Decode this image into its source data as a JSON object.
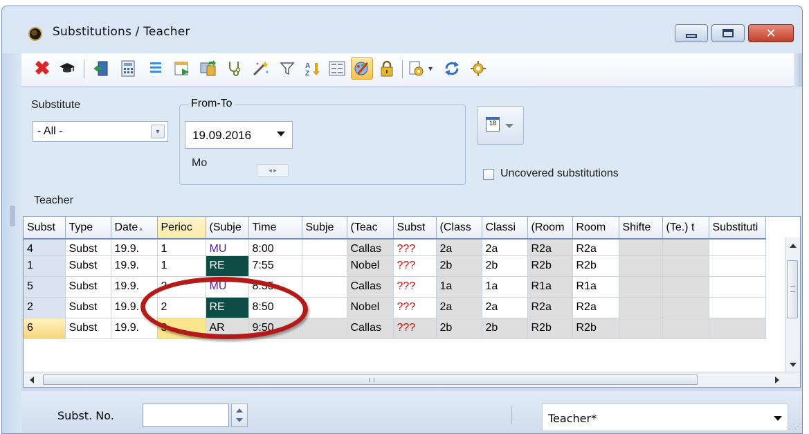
{
  "window": {
    "title": "Substitutions / Teacher"
  },
  "toolbar": {
    "icons": [
      "delete-icon",
      "teacher-cap-icon",
      "exit-icon",
      "calculator-icon",
      "list-icon",
      "timetable-icon",
      "move-icon",
      "stethoscope-icon",
      "magic-wand-icon",
      "filter-icon",
      "sort-icon",
      "grid-icon",
      "edit-colors-icon",
      "lock-icon",
      "print-icon",
      "refresh-icon",
      "settings-icon"
    ],
    "active_icon": "edit-colors-icon",
    "dropdown_glyph": "▾"
  },
  "filters": {
    "substitute_label": "Substitute",
    "substitute_value": "- All -",
    "from_to_label": "From-To",
    "date_value": "19.09.2016",
    "weekday": "Mo",
    "spin_glyphs": "◂ ▸",
    "uncovered_label": "Uncovered substitutions",
    "uncovered_checked": false,
    "teacher_label": "Teacher"
  },
  "grid": {
    "columns": [
      "Subst",
      "Type",
      "Date",
      "Perioc",
      "(Subje",
      "Time",
      "Subje",
      "(Teac",
      "Subst",
      "(Class",
      "Classi",
      "(Room",
      "Room",
      "Shifte",
      "(Te.) t",
      "Substituti"
    ],
    "sort_indicator": "▲",
    "rows": [
      {
        "subst": "4",
        "type": "Subst",
        "date": "19.9.",
        "period": "1",
        "subject_old": "MU",
        "time": "8:00",
        "subject": "",
        "teacher_old": "Callas",
        "teacher": "???",
        "class_old": "2a",
        "class": "2a",
        "room_old": "R2a",
        "room": "R2a"
      },
      {
        "subst": "1",
        "type": "Subst",
        "date": "19.9.",
        "period": "1",
        "subject_old": "RE",
        "time": "7:55",
        "subject": "",
        "teacher_old": "Nobel",
        "teacher": "???",
        "class_old": "2b",
        "class": "2b",
        "room_old": "R2b",
        "room": "R2b"
      },
      {
        "subst": "5",
        "type": "Subst",
        "date": "19.9.",
        "period": "2",
        "subject_old": "MU",
        "time": "8:55",
        "subject": "",
        "teacher_old": "Callas",
        "teacher": "???",
        "class_old": "1a",
        "class": "1a",
        "room_old": "R1a",
        "room": "R1a"
      },
      {
        "subst": "2",
        "type": "Subst",
        "date": "19.9.",
        "period": "2",
        "subject_old": "RE",
        "time": "8:50",
        "subject": "",
        "teacher_old": "Nobel",
        "teacher": "???",
        "class_old": "2a",
        "class": "2a",
        "room_old": "R2a",
        "room": "R2a"
      },
      {
        "subst": "6",
        "type": "Subst",
        "date": "19.9.",
        "period": "3",
        "subject_old": "AR",
        "time": "9:50",
        "subject": "",
        "teacher_old": "Callas",
        "teacher": "???",
        "class_old": "2b",
        "class": "2b",
        "room_old": "R2b",
        "room": "R2b"
      }
    ],
    "hscroll_glyph": "III",
    "colors": {
      "dark_cell": "#0d4d45",
      "missing_teacher": "#e00000",
      "subject_purple": "#5b1aa5",
      "period_highlight": "#f9e58b"
    }
  },
  "statusbar": {
    "subst_no_label": "Subst. No.",
    "subst_no_value": "",
    "view_value": "Teacher*"
  },
  "annotation": {
    "color": "#b41a17"
  }
}
